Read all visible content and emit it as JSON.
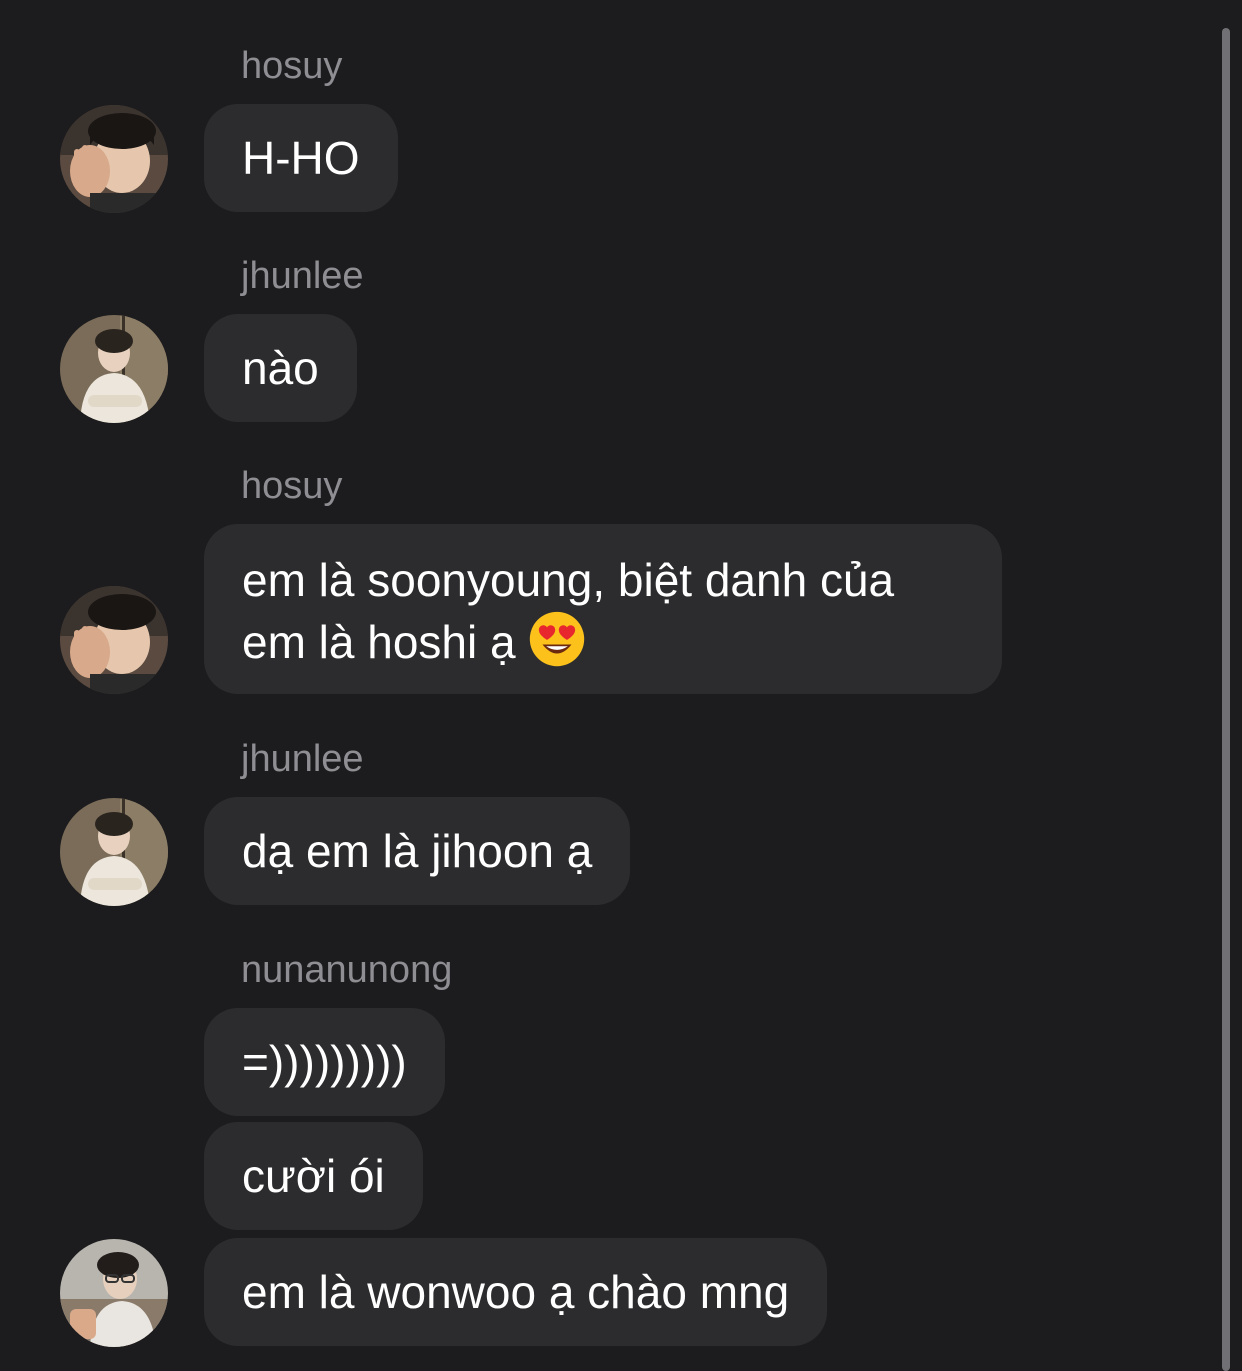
{
  "messages": [
    {
      "sender": "hosuy",
      "text": "H-HO",
      "avatar": "hosuy-avatar"
    },
    {
      "sender": "jhunlee",
      "text": "nào",
      "avatar": "jhunlee-avatar"
    },
    {
      "sender": "hosuy",
      "line1": "em là soonyoung, biệt danh của",
      "line2": "em là hoshi ạ",
      "emoji": "heart-eyes-emoji",
      "avatar": "hosuy-avatar"
    },
    {
      "sender": "jhunlee",
      "text": "dạ em là jihoon ạ",
      "avatar": "jhunlee-avatar"
    },
    {
      "sender": "nunanunong",
      "texts": [
        "=)))))))))",
        "cười ói",
        "em là wonwoo ạ chào mng"
      ],
      "avatar": "nunanunong-avatar"
    }
  ],
  "colors": {
    "background": "#1c1c1e",
    "bubble": "#2c2c2e",
    "sender_text": "#8e8e93",
    "message_text": "#ffffff"
  }
}
